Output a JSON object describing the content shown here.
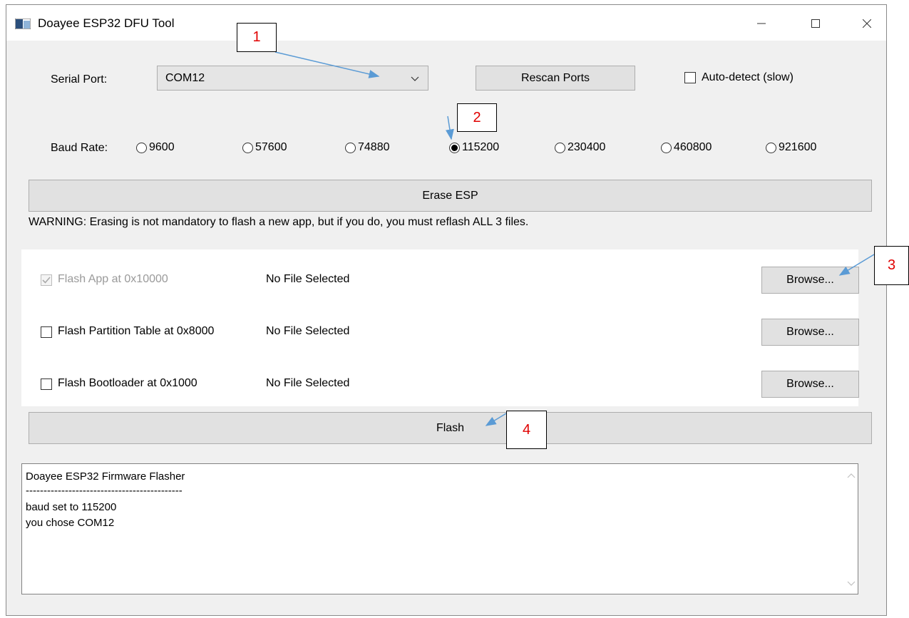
{
  "window": {
    "title": "Doayee ESP32 DFU Tool"
  },
  "serial": {
    "label": "Serial Port:",
    "selected_port": "COM12",
    "rescan_label": "Rescan Ports",
    "autodetect_label": "Auto-detect (slow)",
    "autodetect_checked": false
  },
  "baud": {
    "label": "Baud Rate:",
    "options": [
      "9600",
      "57600",
      "74880",
      "115200",
      "230400",
      "460800",
      "921600"
    ],
    "selected": "115200"
  },
  "erase": {
    "button_label": "Erase ESP",
    "warning": "WARNING: Erasing is not mandatory to flash a new app, but if you do, you must reflash ALL 3 files."
  },
  "files": [
    {
      "label": "Flash App at 0x10000",
      "status": "No File Selected",
      "browse_label": "Browse...",
      "checked": true,
      "disabled": true
    },
    {
      "label": "Flash Partition Table at 0x8000",
      "status": "No File Selected",
      "browse_label": "Browse...",
      "checked": false,
      "disabled": false
    },
    {
      "label": "Flash Bootloader at 0x1000",
      "status": "No File Selected",
      "browse_label": "Browse...",
      "checked": false,
      "disabled": false
    }
  ],
  "flash": {
    "button_label": "Flash"
  },
  "log": {
    "lines": [
      "Doayee ESP32 Firmware Flasher",
      "--------------------------------------------",
      "baud set to 115200",
      "you chose COM12"
    ]
  },
  "annotations": [
    "1",
    "2",
    "3",
    "4"
  ],
  "icons": {
    "app": "app-window-icon",
    "minimize": "minimize-icon",
    "maximize": "maximize-icon",
    "close": "close-icon",
    "dropdown": "chevron-down-icon"
  },
  "colors": {
    "annotation_text": "#e00000",
    "arrow": "#5b9bd5"
  }
}
